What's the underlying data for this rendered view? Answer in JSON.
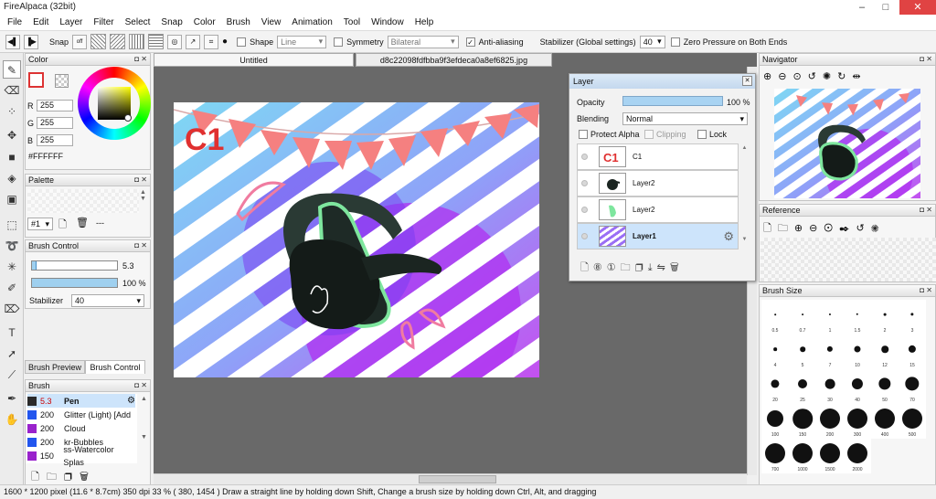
{
  "window": {
    "title": "FireAlpaca (32bit)",
    "min": "–",
    "max": "□",
    "close": "✕"
  },
  "menu": [
    "File",
    "Edit",
    "Layer",
    "Filter",
    "Select",
    "Snap",
    "Color",
    "Brush",
    "View",
    "Animation",
    "Tool",
    "Window",
    "Help"
  ],
  "toolbar": {
    "snap_label": "Snap",
    "shape_label": "Shape",
    "shape_value": "Line",
    "symmetry_label": "Symmetry",
    "symmetry_value": "Bilateral",
    "antialias_label": "Anti-aliasing",
    "antialias_checked": "✓",
    "stabilizer_label": "Stabilizer (Global settings)",
    "stabilizer_value": "40",
    "zero_pressure_label": "Zero Pressure on Both Ends"
  },
  "color_panel": {
    "title": "Color",
    "r_label": "R",
    "r": "255",
    "g_label": "G",
    "g": "255",
    "b_label": "B",
    "b": "255",
    "hex": "#FFFFFF"
  },
  "palette_panel": {
    "title": "Palette",
    "set": "#1",
    "dash": "---"
  },
  "brush_control": {
    "title": "Brush Control",
    "size": "5.3",
    "size_fraction": 0.05,
    "opacity": "100 %",
    "opacity_fraction": 1.0,
    "stabilizer_label": "Stabilizer",
    "stabilizer_value": "40"
  },
  "brush_tabs": {
    "preview": "Brush Preview",
    "control": "Brush Control"
  },
  "brush_panel": {
    "title": "Brush",
    "items": [
      {
        "size": "5.3",
        "name": "Pen",
        "color": "#2a2a2a"
      },
      {
        "size": "200",
        "name": "Glitter (Light) [Add",
        "color": "#2255ee"
      },
      {
        "size": "200",
        "name": "Cloud",
        "color": "#9922cc"
      },
      {
        "size": "200",
        "name": "kr-Bubbles",
        "color": "#2255ee"
      },
      {
        "size": "150",
        "name": "ss-Watercolor Splas",
        "color": "#9922cc"
      }
    ]
  },
  "tabs": {
    "tab1": "Untitled",
    "tab2": "d8c22098fdfbba9f3efdeca0a8ef6825.jpg"
  },
  "artwork": {
    "text": "C1"
  },
  "layer_panel": {
    "title": "Layer",
    "opacity_label": "Opacity",
    "opacity_value": "100 %",
    "opacity_fraction": 1.0,
    "blending_label": "Blending",
    "blending_value": "Normal",
    "protect_alpha": "Protect Alpha",
    "clipping": "Clipping",
    "lock": "Lock",
    "layers": [
      {
        "name": "C1",
        "selected": false
      },
      {
        "name": "Layer2",
        "selected": false
      },
      {
        "name": "Layer2",
        "selected": false
      },
      {
        "name": "Layer1",
        "selected": true
      }
    ]
  },
  "navigator": {
    "title": "Navigator"
  },
  "reference": {
    "title": "Reference"
  },
  "brush_size": {
    "title": "Brush Size",
    "sizes": [
      "0.5",
      "0.7",
      "1",
      "1.5",
      "2",
      "3",
      "4",
      "5",
      "7",
      "10",
      "12",
      "15",
      "20",
      "25",
      "30",
      "40",
      "50",
      "70",
      "100",
      "150",
      "200",
      "300",
      "400",
      "500",
      "700",
      "1000",
      "1500",
      "2000"
    ]
  },
  "status": {
    "dimensions": "1600 * 1200 pixel",
    "physical": "(11.6 * 8.7cm)",
    "dpi": "350 dpi",
    "zoom": "33 %",
    "coords": "( 380, 1454 )",
    "hint": "Draw a straight line by holding down Shift, Change a brush size by holding down Ctrl, Alt, and dragging"
  }
}
